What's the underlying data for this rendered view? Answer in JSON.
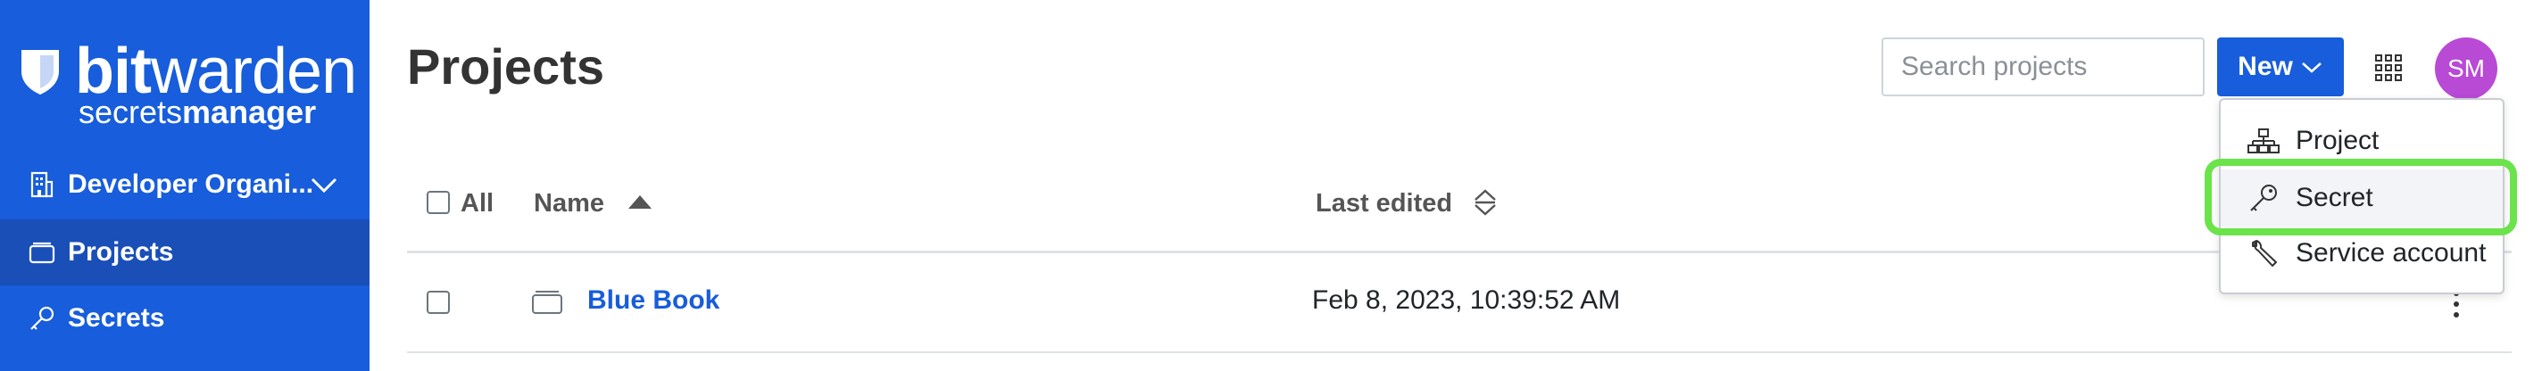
{
  "brand": {
    "name_bold": "bit",
    "name_light": "warden",
    "sub_light": "secrets",
    "sub_bold": "manager"
  },
  "sidebar": {
    "org_label": "Developer Organi...",
    "items": [
      {
        "label": "Projects",
        "active": true,
        "icon": "folder-icon"
      },
      {
        "label": "Secrets",
        "active": false,
        "icon": "key-icon"
      }
    ]
  },
  "header": {
    "title": "Projects",
    "search_placeholder": "Search projects",
    "new_label": "New",
    "avatar_initials": "SM"
  },
  "new_menu": {
    "items": [
      {
        "label": "Project",
        "icon": "project-tree-icon"
      },
      {
        "label": "Secret",
        "icon": "key-icon",
        "highlighted": true
      },
      {
        "label": "Service account",
        "icon": "wrench-icon"
      }
    ]
  },
  "table": {
    "select_all_label": "All",
    "columns": {
      "name": "Name",
      "last_edited": "Last edited"
    },
    "rows": [
      {
        "name": "Blue Book",
        "last_edited": "Feb 8, 2023, 10:39:52 AM"
      }
    ]
  },
  "colors": {
    "brand_blue": "#175ddc",
    "avatar": "#b84ad6",
    "highlight": "#6be34a"
  }
}
